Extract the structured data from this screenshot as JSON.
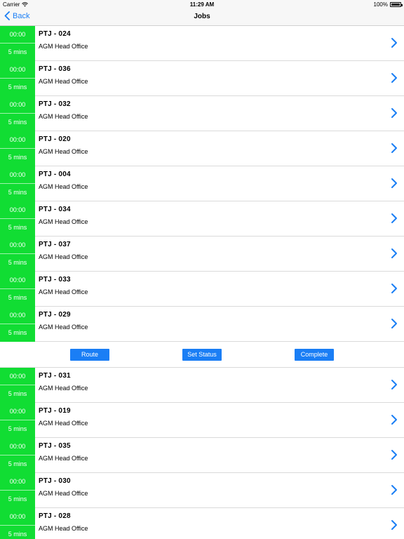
{
  "status_bar": {
    "carrier": "Carrier",
    "time": "11:29 AM",
    "battery": "100%"
  },
  "nav": {
    "back_label": "Back",
    "title": "Jobs"
  },
  "colors": {
    "accent": "#1a7ef5",
    "time_block": "#11dd33"
  },
  "jobs_top": [
    {
      "start": "00:00",
      "duration": "5 mins",
      "code": "PTJ - 024",
      "location": "AGM Head Office"
    },
    {
      "start": "00:00",
      "duration": "5 mins",
      "code": "PTJ - 036",
      "location": "AGM Head Office"
    },
    {
      "start": "00:00",
      "duration": "5 mins",
      "code": "PTJ - 032",
      "location": "AGM Head Office"
    },
    {
      "start": "00:00",
      "duration": "5 mins",
      "code": "PTJ - 020",
      "location": "AGM Head Office"
    },
    {
      "start": "00:00",
      "duration": "5 mins",
      "code": "PTJ - 004",
      "location": "AGM Head Office"
    },
    {
      "start": "00:00",
      "duration": "5 mins",
      "code": "PTJ - 034",
      "location": "AGM Head Office"
    },
    {
      "start": "00:00",
      "duration": "5 mins",
      "code": "PTJ - 037",
      "location": "AGM Head Office"
    },
    {
      "start": "00:00",
      "duration": "5 mins",
      "code": "PTJ - 033",
      "location": "AGM Head Office"
    },
    {
      "start": "00:00",
      "duration": "5 mins",
      "code": "PTJ - 029",
      "location": "AGM Head Office"
    }
  ],
  "actions": {
    "route": "Route",
    "set_status": "Set Status",
    "complete": "Complete"
  },
  "jobs_bottom": [
    {
      "start": "00:00",
      "duration": "5 mins",
      "code": "PTJ - 031",
      "location": "AGM Head Office"
    },
    {
      "start": "00:00",
      "duration": "5 mins",
      "code": "PTJ - 019",
      "location": "AGM Head Office"
    },
    {
      "start": "00:00",
      "duration": "5 mins",
      "code": "PTJ - 035",
      "location": "AGM Head Office"
    },
    {
      "start": "00:00",
      "duration": "5 mins",
      "code": "PTJ - 030",
      "location": "AGM Head Office"
    },
    {
      "start": "00:00",
      "duration": "5 mins",
      "code": "PTJ - 028",
      "location": "AGM Head Office"
    }
  ]
}
